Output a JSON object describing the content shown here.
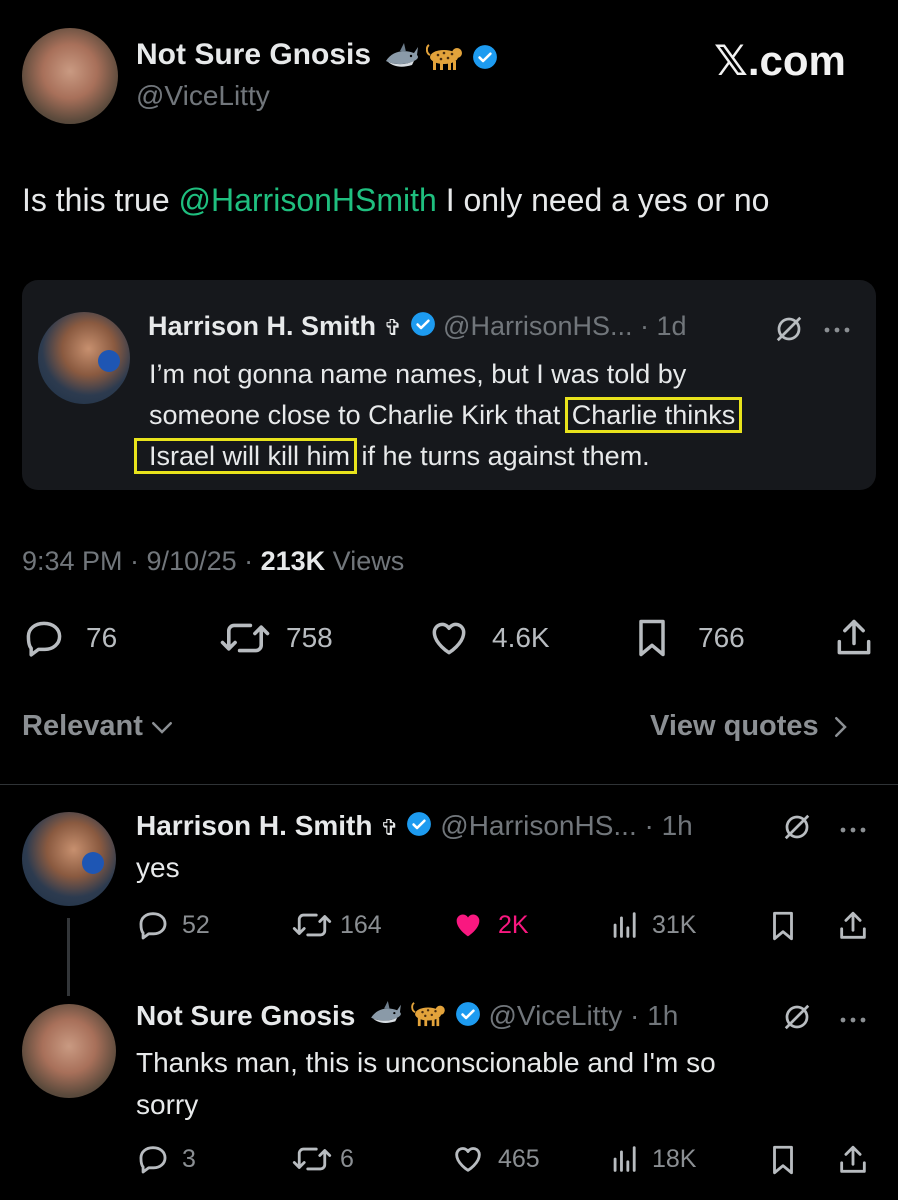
{
  "brand": {
    "watermark": "𝕏.com"
  },
  "main_tweet": {
    "author_name": "Not Sure Gnosis",
    "author_handle": "@ViceLitty",
    "text_prefix": "Is this true ",
    "mention": "@HarrisonHSmith",
    "text_suffix": " I only need a yes or no",
    "timestamp": "9:34 PM · 9/10/25 · ",
    "views_count": "213K",
    "views_label": " Views",
    "stats": {
      "replies": "76",
      "reposts": "758",
      "likes": "4.6K",
      "bookmarks": "766"
    }
  },
  "quoted_tweet": {
    "author_name": "Harrison H. Smith",
    "cross": "✞",
    "handle_time": "@HarrisonHS... · 1d",
    "line1": "I’m not gonna name names, but I was told by",
    "line2_a": "someone close to Charlie Kirk that ",
    "line2_highlight": "Charlie thinks",
    "line3_highlight": "Israel will kill him",
    "line3_b": " if he turns against them."
  },
  "controls": {
    "sort_label": "Relevant",
    "view_quotes_label": "View quotes"
  },
  "replies": [
    {
      "author_name": "Harrison H. Smith",
      "cross": "✞",
      "handle_time": "@HarrisonHS... · 1h",
      "text": "yes",
      "stats": {
        "replies": "52",
        "reposts": "164",
        "likes": "2K",
        "views": "31K"
      },
      "liked": true
    },
    {
      "author_name": "Not Sure Gnosis",
      "handle_time": "@ViceLitty · 1h",
      "text_line1": "Thanks man, this is unconscionable and I'm so",
      "text_line2": "sorry",
      "stats": {
        "replies": "3",
        "reposts": "6",
        "likes": "465",
        "views": "18K"
      },
      "liked": false
    }
  ],
  "colors": {
    "background": "#000000",
    "text": "#e7e9ea",
    "muted": "#71767b",
    "mention": "#1fbf7f",
    "verified": "#1d9bf0",
    "like_active": "#f91880",
    "highlight": "#e8e31c",
    "quote_card": "#16181c"
  },
  "icons": [
    "shark-emoji",
    "leopard-emoji",
    "verified-badge-icon",
    "grok-icon",
    "more-icon",
    "reply-icon",
    "repost-icon",
    "like-icon",
    "bookmark-icon",
    "share-icon",
    "views-icon",
    "chevron-down-icon",
    "chevron-right-icon"
  ]
}
